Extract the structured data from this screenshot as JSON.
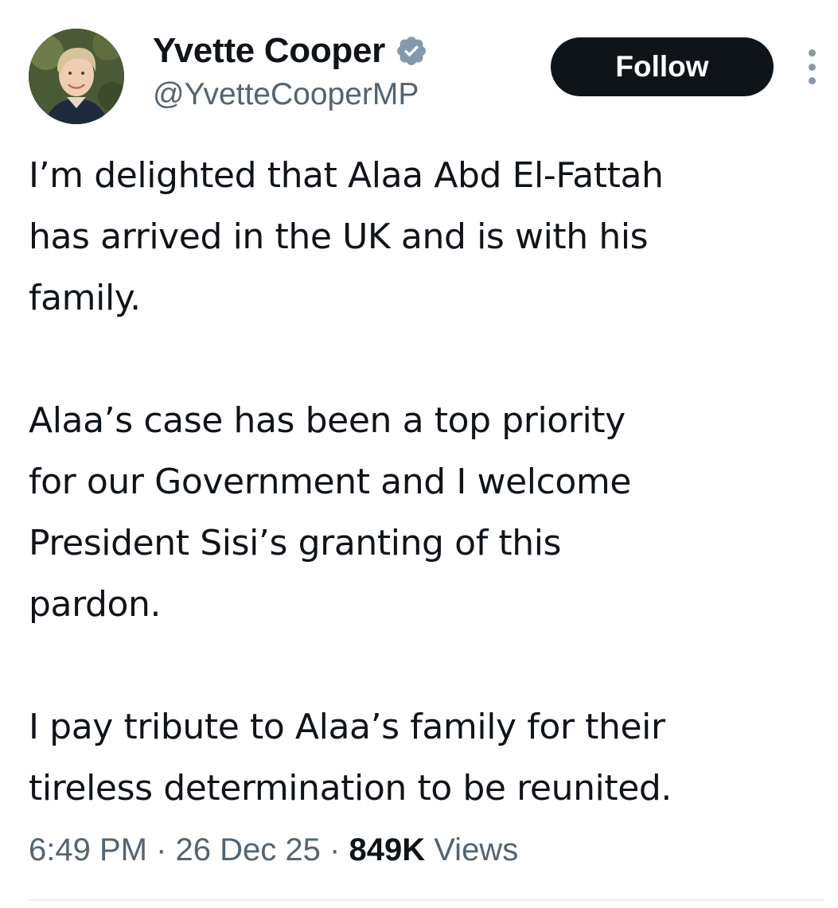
{
  "tweet": {
    "author": {
      "display_name": "Yvette Cooper",
      "handle": "@YvetteCooperMP",
      "verified": true,
      "verified_badge_color": "#829aab"
    },
    "follow_label": "Follow",
    "paragraphs": [
      "I’m delighted that Alaa Abd El-Fattah\nhas arrived in the UK and is with his\nfamily.",
      "Alaa’s case has been a top priority\nfor our Government and I welcome\nPresident Sisi’s granting of this\npardon.",
      "I pay tribute to Alaa’s family for their\ntireless determination to be reunited."
    ],
    "meta": {
      "time": "6:49 PM",
      "separator": "·",
      "date": "26 Dec 25",
      "views_count": "849K",
      "views_label": "Views"
    }
  },
  "icons": {
    "avatar": "avatar-photo",
    "verified": "verified-badge-icon",
    "more": "more-options-icon"
  },
  "colors": {
    "text_primary": "#0f1419",
    "text_secondary": "#536471",
    "button_bg": "#0f1419",
    "button_text": "#ffffff"
  }
}
